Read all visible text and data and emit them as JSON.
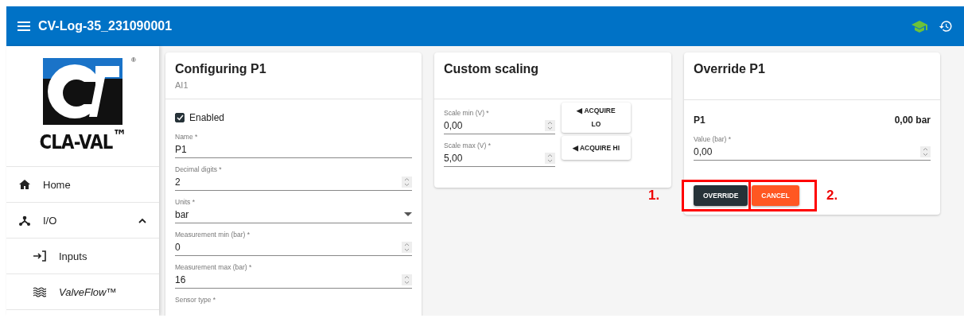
{
  "app_bar": {
    "title": "CV-Log-35_231090001"
  },
  "sidebar": {
    "logo_text": "CLA-VAL$^{™}$",
    "registered_mark": "®",
    "items": [
      {
        "label": "Home",
        "kind": "home"
      },
      {
        "label": "I/O",
        "kind": "io",
        "expanded": true,
        "children": [
          {
            "label": "Inputs",
            "kind": "inputs"
          },
          {
            "label": "ValveFlow™",
            "kind": "brand"
          }
        ]
      }
    ]
  },
  "config_card": {
    "title": "Configuring P1",
    "subtitle": "AI1",
    "enabled": {
      "label": "Enabled",
      "checked": true
    },
    "fields": [
      {
        "label": "Name *",
        "value": "P1",
        "kind": "text"
      },
      {
        "label": "Decimal digits *",
        "value": "2",
        "kind": "number"
      },
      {
        "label": "Units *",
        "value": "bar",
        "kind": "select"
      },
      {
        "label": "Measurement min (bar) *",
        "value": "0",
        "kind": "number"
      },
      {
        "label": "Measurement max (bar) *",
        "value": "16",
        "kind": "number"
      },
      {
        "label": "Sensor type *",
        "kind": "label"
      }
    ]
  },
  "scaling_card": {
    "title": "Custom scaling",
    "fields": [
      {
        "label": "Scale min (V) *",
        "value": "0,00",
        "button": "◀ ACQUIRE\nLO"
      },
      {
        "label": "Scale max (V) *",
        "value": "5,00",
        "button": "◀ ACQUIRE HI"
      }
    ]
  },
  "override_card": {
    "title": "Override P1",
    "channel": "P1",
    "reading": "0,00 bar",
    "field": {
      "label": "Value (bar) *",
      "value": "0,00"
    },
    "buttons": [
      {
        "label": "OVERRIDE",
        "kind": "primary",
        "marker": "1."
      },
      {
        "label": "CANCEL",
        "kind": "warn",
        "marker": "2."
      }
    ]
  }
}
